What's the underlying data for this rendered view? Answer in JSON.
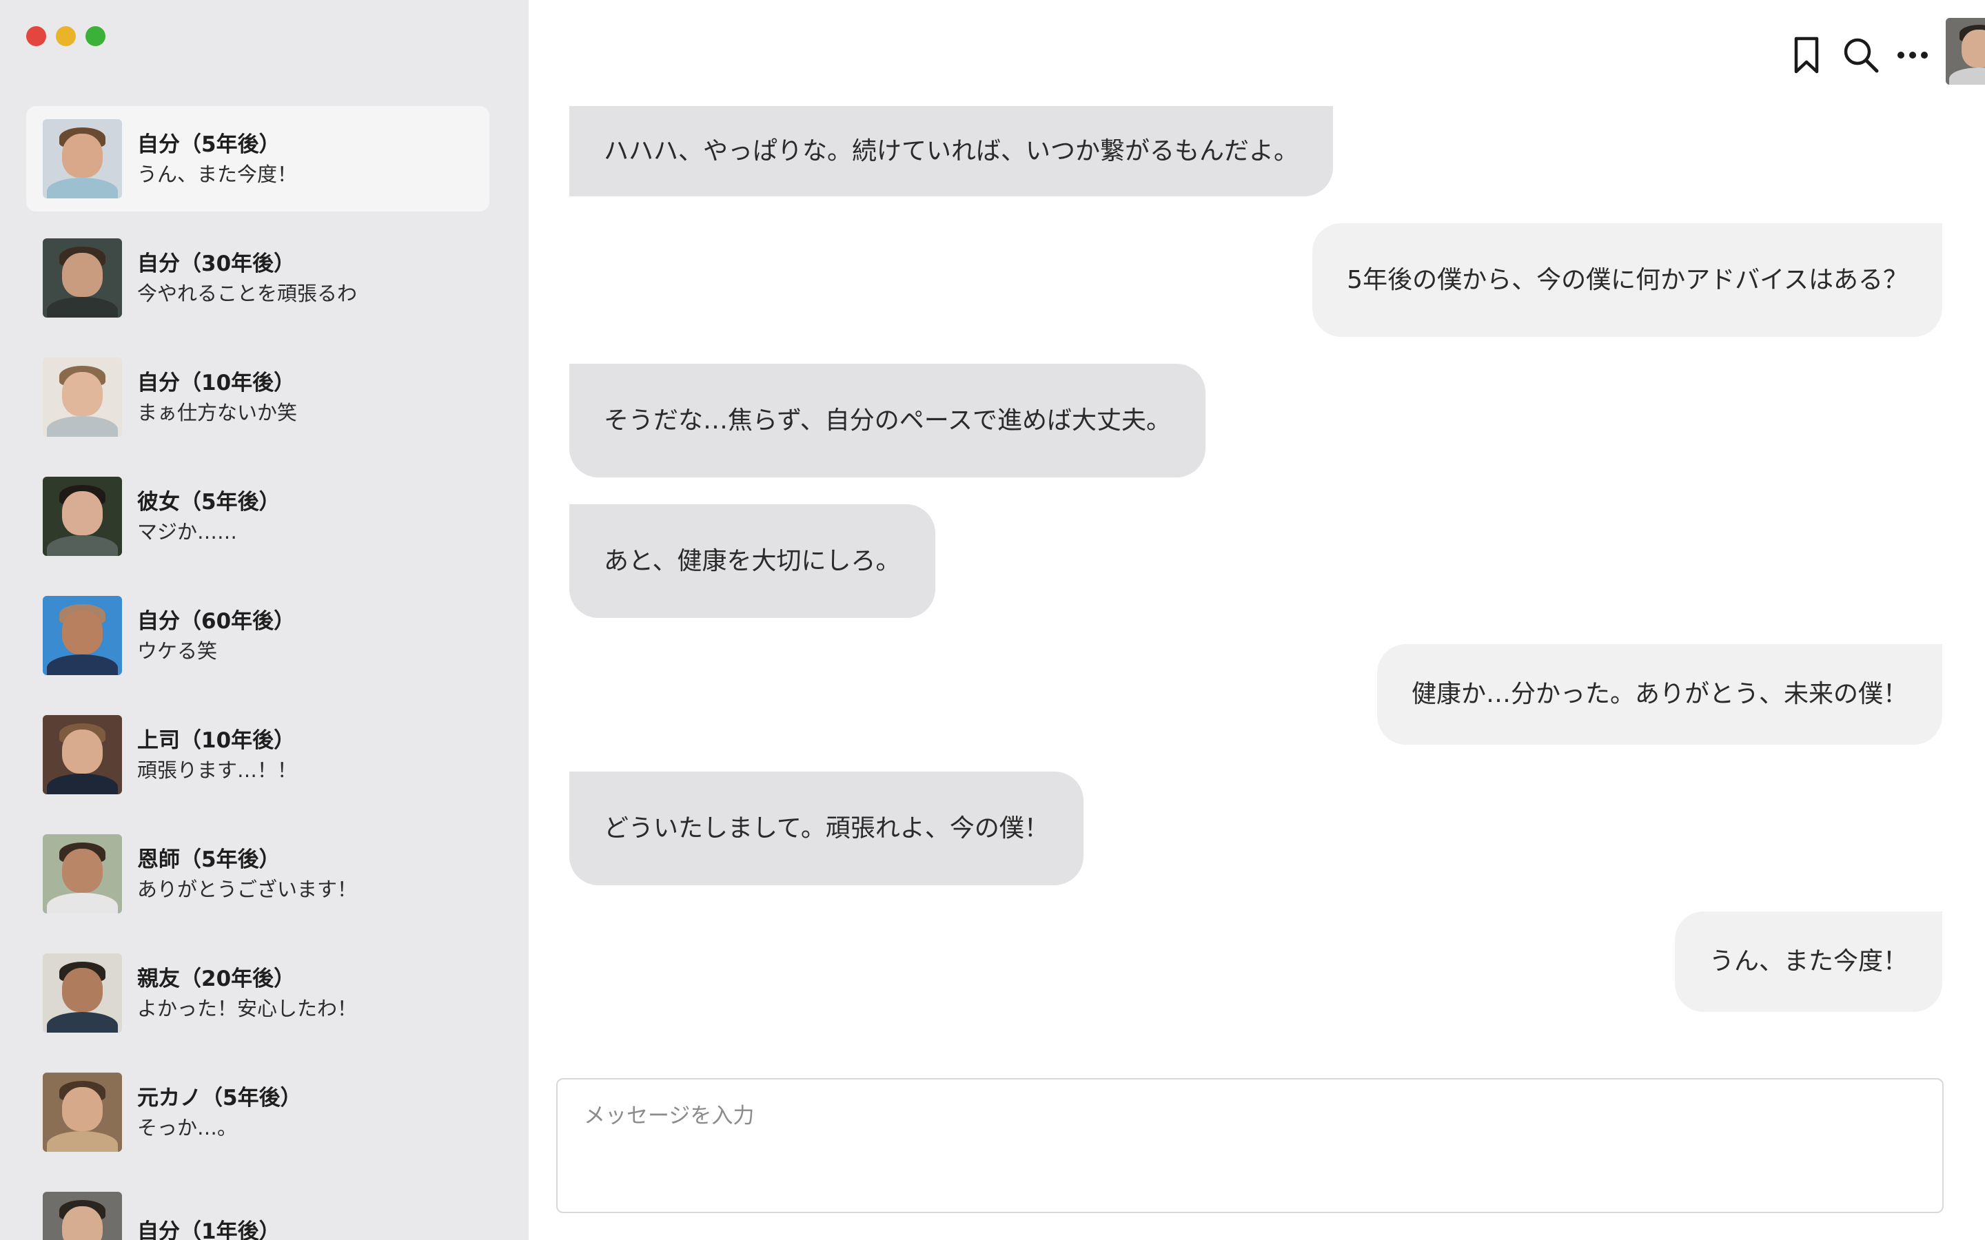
{
  "window": {
    "controls": [
      "close",
      "minimize",
      "zoom"
    ]
  },
  "sidebar": {
    "conversations": [
      {
        "name": "自分（5年後）",
        "preview": "うん、また今度！",
        "active": true
      },
      {
        "name": "自分（30年後）",
        "preview": "今やれることを頑張るわ"
      },
      {
        "name": "自分（10年後）",
        "preview": "まぁ仕方ないか笑"
      },
      {
        "name": "彼女（5年後）",
        "preview": "マジか……"
      },
      {
        "name": "自分（60年後）",
        "preview": "ウケる笑"
      },
      {
        "name": "上司（10年後）",
        "preview": "頑張ります…！！"
      },
      {
        "name": "恩師（5年後）",
        "preview": "ありがとうございます！"
      },
      {
        "name": "親友（20年後）",
        "preview": "よかった！安心したわ！"
      },
      {
        "name": "元カノ（5年後）",
        "preview": "そっか…。"
      },
      {
        "name": "自分（1年後）",
        "preview": ""
      }
    ]
  },
  "toolbar": {
    "icons": [
      "bookmark-icon",
      "search-icon",
      "more-icon",
      "profile-avatar"
    ]
  },
  "messages": [
    {
      "from": "them",
      "text": "ハハハ、やっぱりな。続けていれば、いつか繋がるもんだよ。"
    },
    {
      "from": "me",
      "text": "5年後の僕から、今の僕に何かアドバイスはある？"
    },
    {
      "from": "them",
      "text": "そうだな…焦らず、自分のペースで進めば大丈夫。"
    },
    {
      "from": "them",
      "text": "あと、健康を大切にしろ。"
    },
    {
      "from": "me",
      "text": "健康か…分かった。ありがとう、未来の僕！"
    },
    {
      "from": "them",
      "text": "どういたしまして。頑張れよ、今の僕！"
    },
    {
      "from": "me",
      "text": "うん、また今度！"
    }
  ],
  "composer": {
    "placeholder": "メッセージを入力",
    "value": ""
  }
}
